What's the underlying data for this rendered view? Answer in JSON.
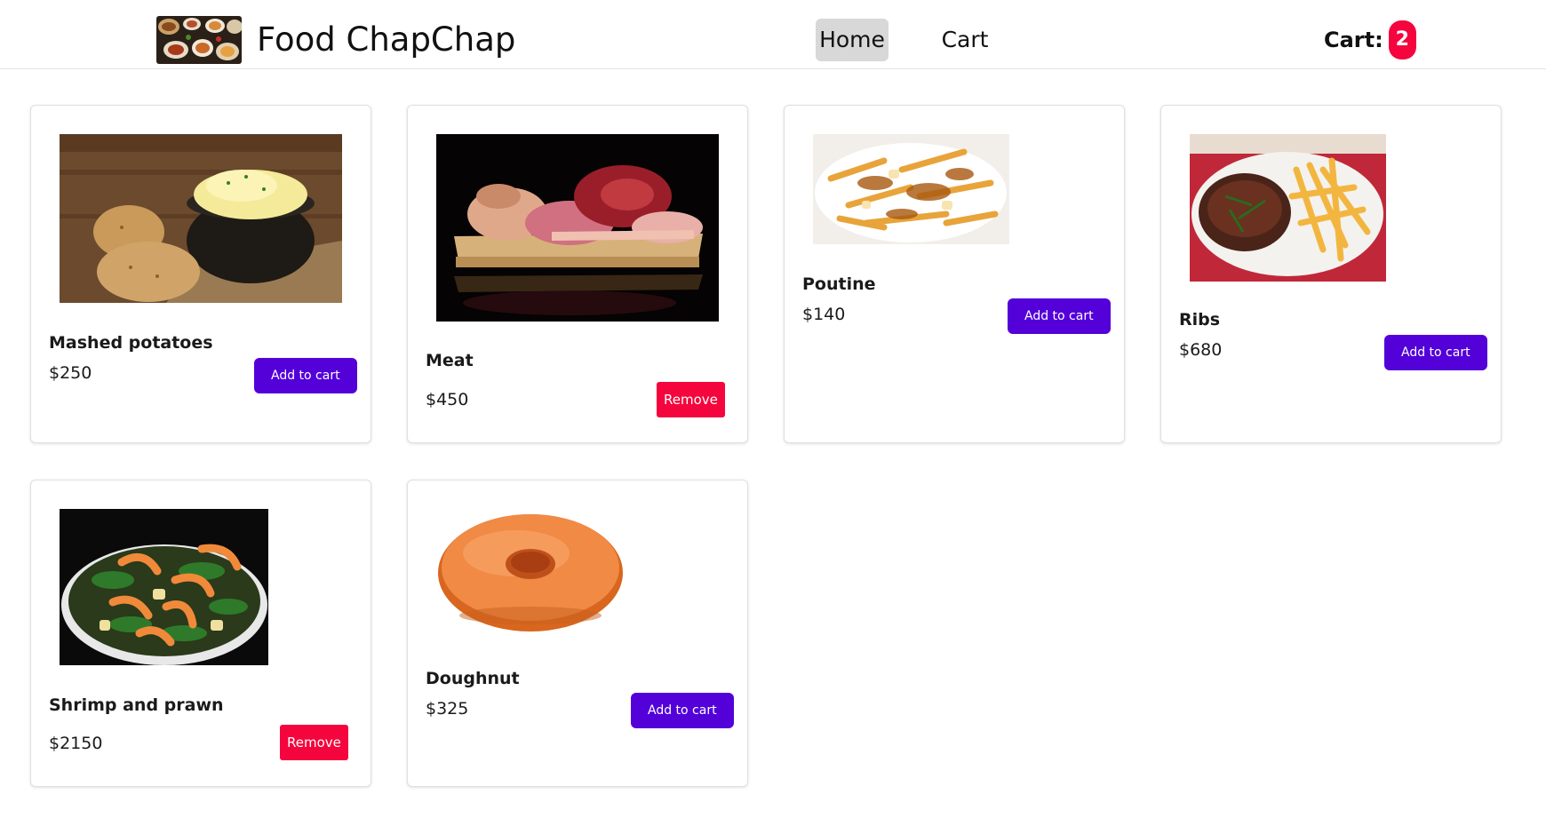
{
  "app": {
    "brand": "Food ChapChap",
    "logo_icon": "food-platter-logo"
  },
  "nav": {
    "home_label": "Home",
    "cart_label": "Cart"
  },
  "cart_indicator": {
    "label": "Cart:",
    "count": "2"
  },
  "colors": {
    "primary_button": "#5300d9",
    "remove_button": "#f5053d",
    "nav_active_bg": "#d8d8d8"
  },
  "products": [
    {
      "name": "Mashed potatoes",
      "price": "$250",
      "action": "Add to cart",
      "in_cart": false,
      "image_icon": "mashed-potatoes-image"
    },
    {
      "name": "Meat",
      "price": "$450",
      "action": "Remove",
      "in_cart": true,
      "image_icon": "meat-image"
    },
    {
      "name": "Poutine",
      "price": "$140",
      "action": "Add to cart",
      "in_cart": false,
      "image_icon": "poutine-image"
    },
    {
      "name": "Ribs",
      "price": "$680",
      "action": "Add to cart",
      "in_cart": false,
      "image_icon": "ribs-image"
    },
    {
      "name": "Shrimp and prawn",
      "price": "$2150",
      "action": "Remove",
      "in_cart": true,
      "image_icon": "shrimp-image"
    },
    {
      "name": "Doughnut",
      "price": "$325",
      "action": "Add to cart",
      "in_cart": false,
      "image_icon": "doughnut-image"
    }
  ]
}
